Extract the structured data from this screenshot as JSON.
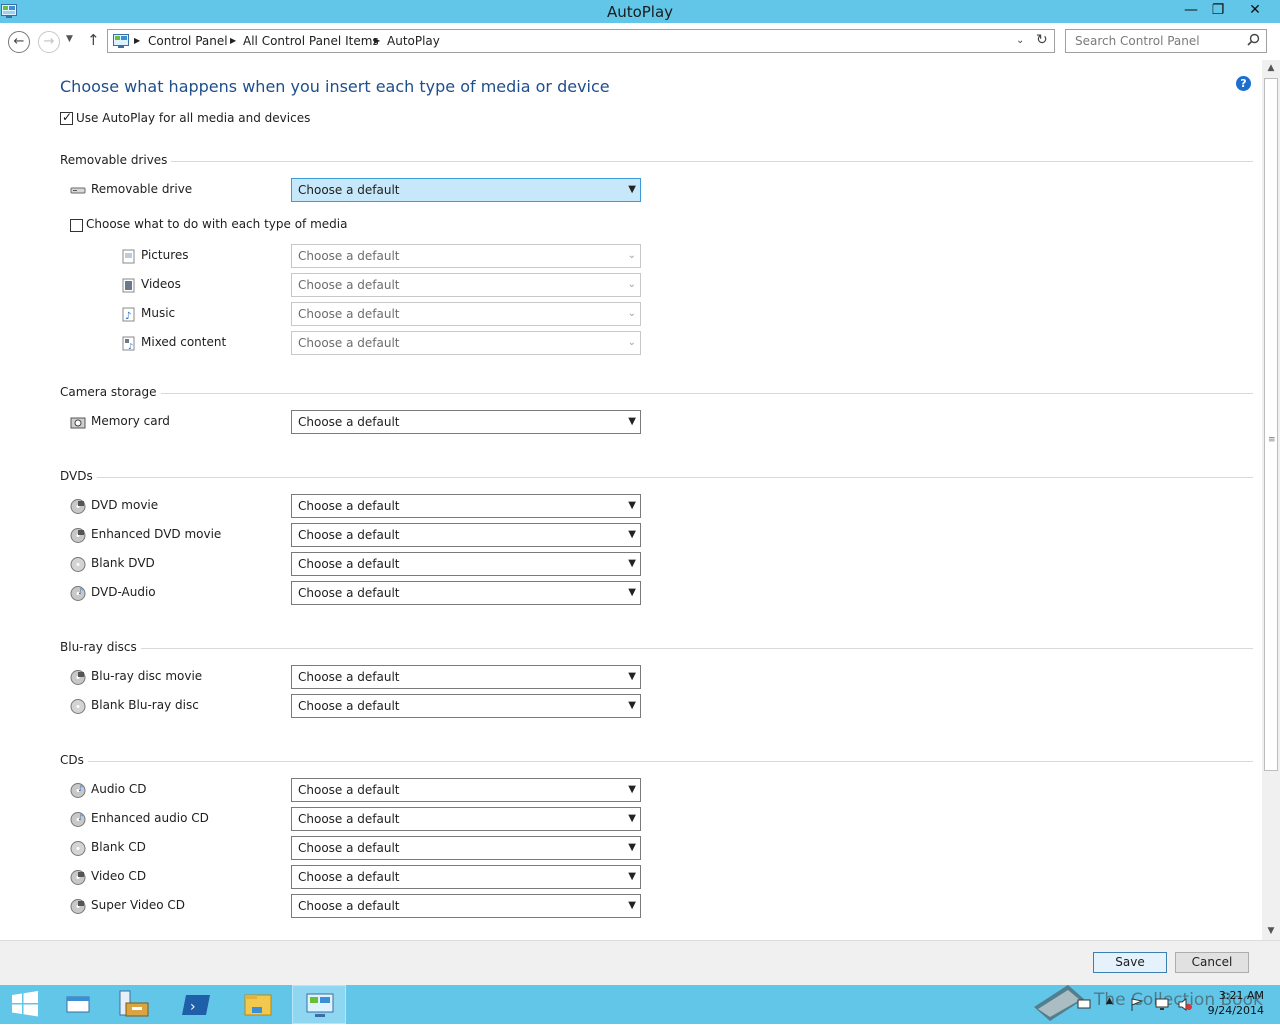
{
  "window": {
    "title": "AutoPlay",
    "minimize": "—",
    "maximize": "❐",
    "close": "✕"
  },
  "nav": {
    "breadcrumbs": [
      "Control Panel",
      "All Control Panel Items",
      "AutoPlay"
    ],
    "search_placeholder": "Search Control Panel"
  },
  "page": {
    "heading": "Choose what happens when you insert each type of media or device",
    "use_autoplay_label": "Use AutoPlay for all media and devices",
    "use_autoplay_checked": true
  },
  "default_choice": "Choose a default",
  "removable": {
    "title": "Removable drives",
    "drive_label": "Removable drive",
    "drive_value": "Choose a default",
    "each_media_label": "Choose what to do with each type of media",
    "each_media_checked": false,
    "media": [
      {
        "label": "Pictures",
        "value": "Choose a default"
      },
      {
        "label": "Videos",
        "value": "Choose a default"
      },
      {
        "label": "Music",
        "value": "Choose a default"
      },
      {
        "label": "Mixed content",
        "value": "Choose a default"
      }
    ]
  },
  "camera": {
    "title": "Camera storage",
    "items": [
      {
        "label": "Memory card",
        "value": "Choose a default"
      }
    ]
  },
  "dvds": {
    "title": "DVDs",
    "items": [
      {
        "label": "DVD movie",
        "value": "Choose a default"
      },
      {
        "label": "Enhanced DVD movie",
        "value": "Choose a default"
      },
      {
        "label": "Blank DVD",
        "value": "Choose a default"
      },
      {
        "label": "DVD-Audio",
        "value": "Choose a default"
      }
    ]
  },
  "bluray": {
    "title": "Blu-ray discs",
    "items": [
      {
        "label": "Blu-ray disc movie",
        "value": "Choose a default"
      },
      {
        "label": "Blank Blu-ray disc",
        "value": "Choose a default"
      }
    ]
  },
  "cds": {
    "title": "CDs",
    "items": [
      {
        "label": "Audio CD",
        "value": "Choose a default"
      },
      {
        "label": "Enhanced audio CD",
        "value": "Choose a default"
      },
      {
        "label": "Blank CD",
        "value": "Choose a default"
      },
      {
        "label": "Video CD",
        "value": "Choose a default"
      },
      {
        "label": "Super Video CD",
        "value": "Choose a default"
      }
    ]
  },
  "footer": {
    "save": "Save",
    "cancel": "Cancel"
  },
  "taskbar": {
    "time": "3:21 AM",
    "date": "9/24/2014",
    "watermark": "The Collection Book"
  },
  "colors": {
    "accent": "#62c6e8",
    "heading": "#1e4e8c",
    "focus": "#c6e8fa"
  }
}
